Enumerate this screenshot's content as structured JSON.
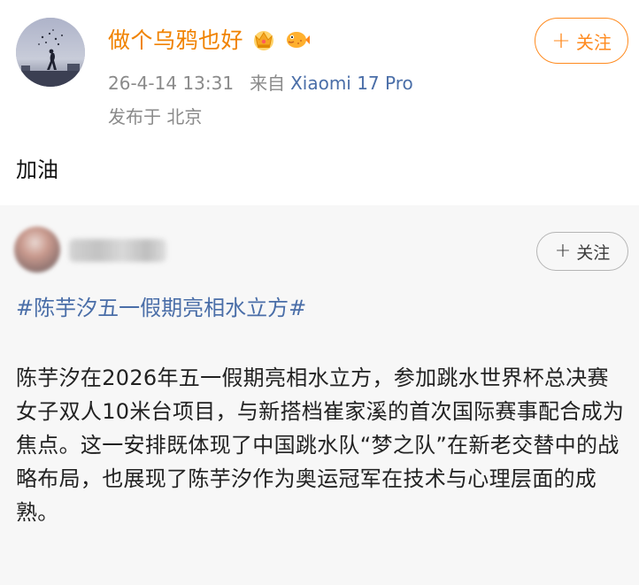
{
  "post": {
    "username": "做个乌鸦也好",
    "badges": [
      "crown-badge-icon",
      "pufferfish-badge-icon"
    ],
    "time": "26-4-14 13:31",
    "from_label": "来自",
    "device": "Xiaomi 17 Pro",
    "location": "发布于 北京",
    "follow_label": "关注",
    "body": "加油"
  },
  "repost": {
    "follow_label": "关注",
    "hashtag": "#陈芋汐五一假期亮相水立方#",
    "text": "陈芋汐在2026年五一假期亮相水立方，参加跳水世界杯总决赛女子双人10米台项目，与新搭档崔家溪的首次国际赛事配合成为焦点。这一安排既体现了中国跳水队“梦之队”在新老交替中的战略布局，也展现了陈芋汐作为奥运冠军在技术与心理层面的成熟。"
  },
  "colors": {
    "username": "#f08200",
    "follow_accent": "#ff8a1e",
    "link_blue": "#4a6ea8",
    "meta_gray": "#8a8a8a",
    "repost_bg": "#f7f7f7"
  }
}
